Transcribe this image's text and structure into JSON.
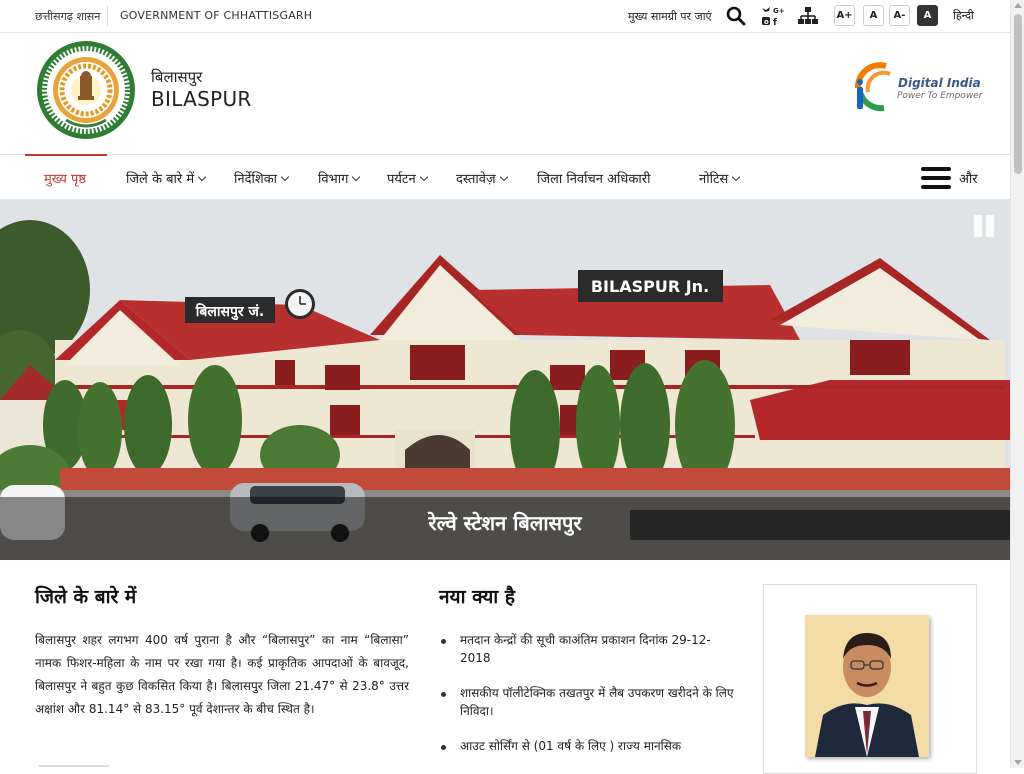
{
  "topbar": {
    "gov_hindi": "छत्तीसगढ़ शासन",
    "gov_english": "GOVERNMENT OF CHHATTISGARH",
    "skip_link": "मुख्य सामग्री पर जाएं",
    "font_increase": "A+",
    "font_normal": "A",
    "font_decrease": "A-",
    "contrast": "A",
    "language": "हिन्दी"
  },
  "header": {
    "district_hindi": "बिलासपुर",
    "district_english": "BILASPUR",
    "digital_india_title": "Digital India",
    "digital_india_tagline": "Power To Empower"
  },
  "nav": {
    "items": [
      {
        "label": "मुख्य पृष्ठ",
        "dropdown": false
      },
      {
        "label": "जिले के बारे में",
        "dropdown": true
      },
      {
        "label": "निर्देशिका",
        "dropdown": true
      },
      {
        "label": "विभाग",
        "dropdown": true
      },
      {
        "label": "पर्यटन",
        "dropdown": true
      },
      {
        "label": "दस्तावेज़",
        "dropdown": true
      },
      {
        "label": "जिला निर्वाचन अधिकारी",
        "dropdown": false
      },
      {
        "label": "नोटिस",
        "dropdown": true
      }
    ],
    "more": "और"
  },
  "banner": {
    "caption": "रेल्वे स्टेशन बिलासपुर",
    "sign_hindi": "बिलासपुर जं.",
    "sign_english": "BILASPUR Jn."
  },
  "about": {
    "heading": "जिले के बारे में",
    "text": "बिलासपुर शहर लगभग 400 वर्ष पुराना है और “बिलासपुर” का नाम “बिलासा” नामक फिशर-महिला के नाम पर रखा गया है। कई प्राकृतिक आपदाओं के बावजूद, बिलासपुर ने बहुत कुछ विकसित किया है। बिलासपुर जिला 21.47° से 23.8° उत्तर अक्षांश और 81.14° से 83.15° पूर्व देशान्तर के बीच स्थित है।"
  },
  "news": {
    "heading": "नया क्या है",
    "items": [
      "मतदान केन्द्रों की सूची काअंतिम प्रकाशन दिनांक 29-12-2018",
      "शासकीय पॉलीटेक्निक तखतपुर में लैब उपकरण खरीदने के लिए निविदा।",
      "आउट सोर्सिंग से (01 वर्ष के लिए ) राज्य मानसिक"
    ]
  },
  "colors": {
    "accent": "#c0392b",
    "sky": "#dde1e4",
    "brick": "#b3262a"
  }
}
